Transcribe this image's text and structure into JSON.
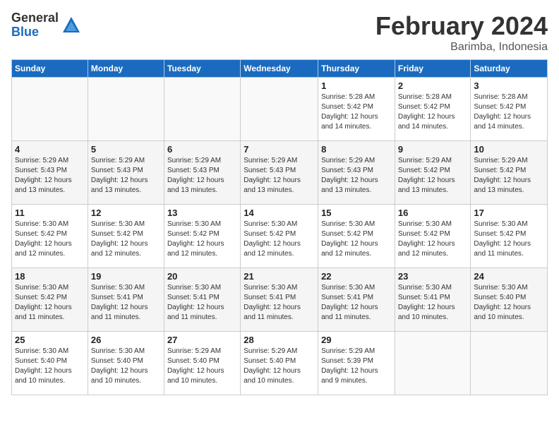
{
  "logo": {
    "general": "General",
    "blue": "Blue"
  },
  "title": "February 2024",
  "subtitle": "Barimba, Indonesia",
  "headers": [
    "Sunday",
    "Monday",
    "Tuesday",
    "Wednesday",
    "Thursday",
    "Friday",
    "Saturday"
  ],
  "weeks": [
    [
      {
        "day": "",
        "info": ""
      },
      {
        "day": "",
        "info": ""
      },
      {
        "day": "",
        "info": ""
      },
      {
        "day": "",
        "info": ""
      },
      {
        "day": "1",
        "info": "Sunrise: 5:28 AM\nSunset: 5:42 PM\nDaylight: 12 hours\nand 14 minutes."
      },
      {
        "day": "2",
        "info": "Sunrise: 5:28 AM\nSunset: 5:42 PM\nDaylight: 12 hours\nand 14 minutes."
      },
      {
        "day": "3",
        "info": "Sunrise: 5:28 AM\nSunset: 5:42 PM\nDaylight: 12 hours\nand 14 minutes."
      }
    ],
    [
      {
        "day": "4",
        "info": "Sunrise: 5:29 AM\nSunset: 5:43 PM\nDaylight: 12 hours\nand 13 minutes."
      },
      {
        "day": "5",
        "info": "Sunrise: 5:29 AM\nSunset: 5:43 PM\nDaylight: 12 hours\nand 13 minutes."
      },
      {
        "day": "6",
        "info": "Sunrise: 5:29 AM\nSunset: 5:43 PM\nDaylight: 12 hours\nand 13 minutes."
      },
      {
        "day": "7",
        "info": "Sunrise: 5:29 AM\nSunset: 5:43 PM\nDaylight: 12 hours\nand 13 minutes."
      },
      {
        "day": "8",
        "info": "Sunrise: 5:29 AM\nSunset: 5:43 PM\nDaylight: 12 hours\nand 13 minutes."
      },
      {
        "day": "9",
        "info": "Sunrise: 5:29 AM\nSunset: 5:42 PM\nDaylight: 12 hours\nand 13 minutes."
      },
      {
        "day": "10",
        "info": "Sunrise: 5:29 AM\nSunset: 5:42 PM\nDaylight: 12 hours\nand 13 minutes."
      }
    ],
    [
      {
        "day": "11",
        "info": "Sunrise: 5:30 AM\nSunset: 5:42 PM\nDaylight: 12 hours\nand 12 minutes."
      },
      {
        "day": "12",
        "info": "Sunrise: 5:30 AM\nSunset: 5:42 PM\nDaylight: 12 hours\nand 12 minutes."
      },
      {
        "day": "13",
        "info": "Sunrise: 5:30 AM\nSunset: 5:42 PM\nDaylight: 12 hours\nand 12 minutes."
      },
      {
        "day": "14",
        "info": "Sunrise: 5:30 AM\nSunset: 5:42 PM\nDaylight: 12 hours\nand 12 minutes."
      },
      {
        "day": "15",
        "info": "Sunrise: 5:30 AM\nSunset: 5:42 PM\nDaylight: 12 hours\nand 12 minutes."
      },
      {
        "day": "16",
        "info": "Sunrise: 5:30 AM\nSunset: 5:42 PM\nDaylight: 12 hours\nand 12 minutes."
      },
      {
        "day": "17",
        "info": "Sunrise: 5:30 AM\nSunset: 5:42 PM\nDaylight: 12 hours\nand 11 minutes."
      }
    ],
    [
      {
        "day": "18",
        "info": "Sunrise: 5:30 AM\nSunset: 5:42 PM\nDaylight: 12 hours\nand 11 minutes."
      },
      {
        "day": "19",
        "info": "Sunrise: 5:30 AM\nSunset: 5:41 PM\nDaylight: 12 hours\nand 11 minutes."
      },
      {
        "day": "20",
        "info": "Sunrise: 5:30 AM\nSunset: 5:41 PM\nDaylight: 12 hours\nand 11 minutes."
      },
      {
        "day": "21",
        "info": "Sunrise: 5:30 AM\nSunset: 5:41 PM\nDaylight: 12 hours\nand 11 minutes."
      },
      {
        "day": "22",
        "info": "Sunrise: 5:30 AM\nSunset: 5:41 PM\nDaylight: 12 hours\nand 11 minutes."
      },
      {
        "day": "23",
        "info": "Sunrise: 5:30 AM\nSunset: 5:41 PM\nDaylight: 12 hours\nand 10 minutes."
      },
      {
        "day": "24",
        "info": "Sunrise: 5:30 AM\nSunset: 5:40 PM\nDaylight: 12 hours\nand 10 minutes."
      }
    ],
    [
      {
        "day": "25",
        "info": "Sunrise: 5:30 AM\nSunset: 5:40 PM\nDaylight: 12 hours\nand 10 minutes."
      },
      {
        "day": "26",
        "info": "Sunrise: 5:30 AM\nSunset: 5:40 PM\nDaylight: 12 hours\nand 10 minutes."
      },
      {
        "day": "27",
        "info": "Sunrise: 5:29 AM\nSunset: 5:40 PM\nDaylight: 12 hours\nand 10 minutes."
      },
      {
        "day": "28",
        "info": "Sunrise: 5:29 AM\nSunset: 5:40 PM\nDaylight: 12 hours\nand 10 minutes."
      },
      {
        "day": "29",
        "info": "Sunrise: 5:29 AM\nSunset: 5:39 PM\nDaylight: 12 hours\nand 9 minutes."
      },
      {
        "day": "",
        "info": ""
      },
      {
        "day": "",
        "info": ""
      }
    ]
  ]
}
